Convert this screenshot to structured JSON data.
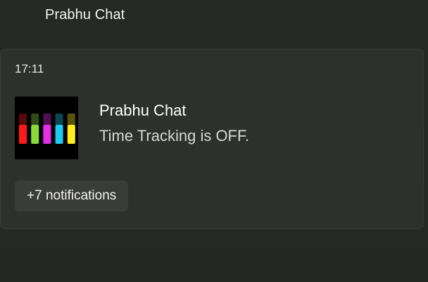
{
  "group": {
    "app_name": "Prabhu Chat"
  },
  "notification": {
    "time": "17:11",
    "title": "Prabhu Chat",
    "message": "Time Tracking is OFF.",
    "more_label": "+7 notifications",
    "icon": "prabhu-chat-logo-icon",
    "logo_bar_colors": [
      "#ff1a1a",
      "#8cd93a",
      "#e62ee6",
      "#1ec8f0",
      "#ffee1a"
    ]
  }
}
